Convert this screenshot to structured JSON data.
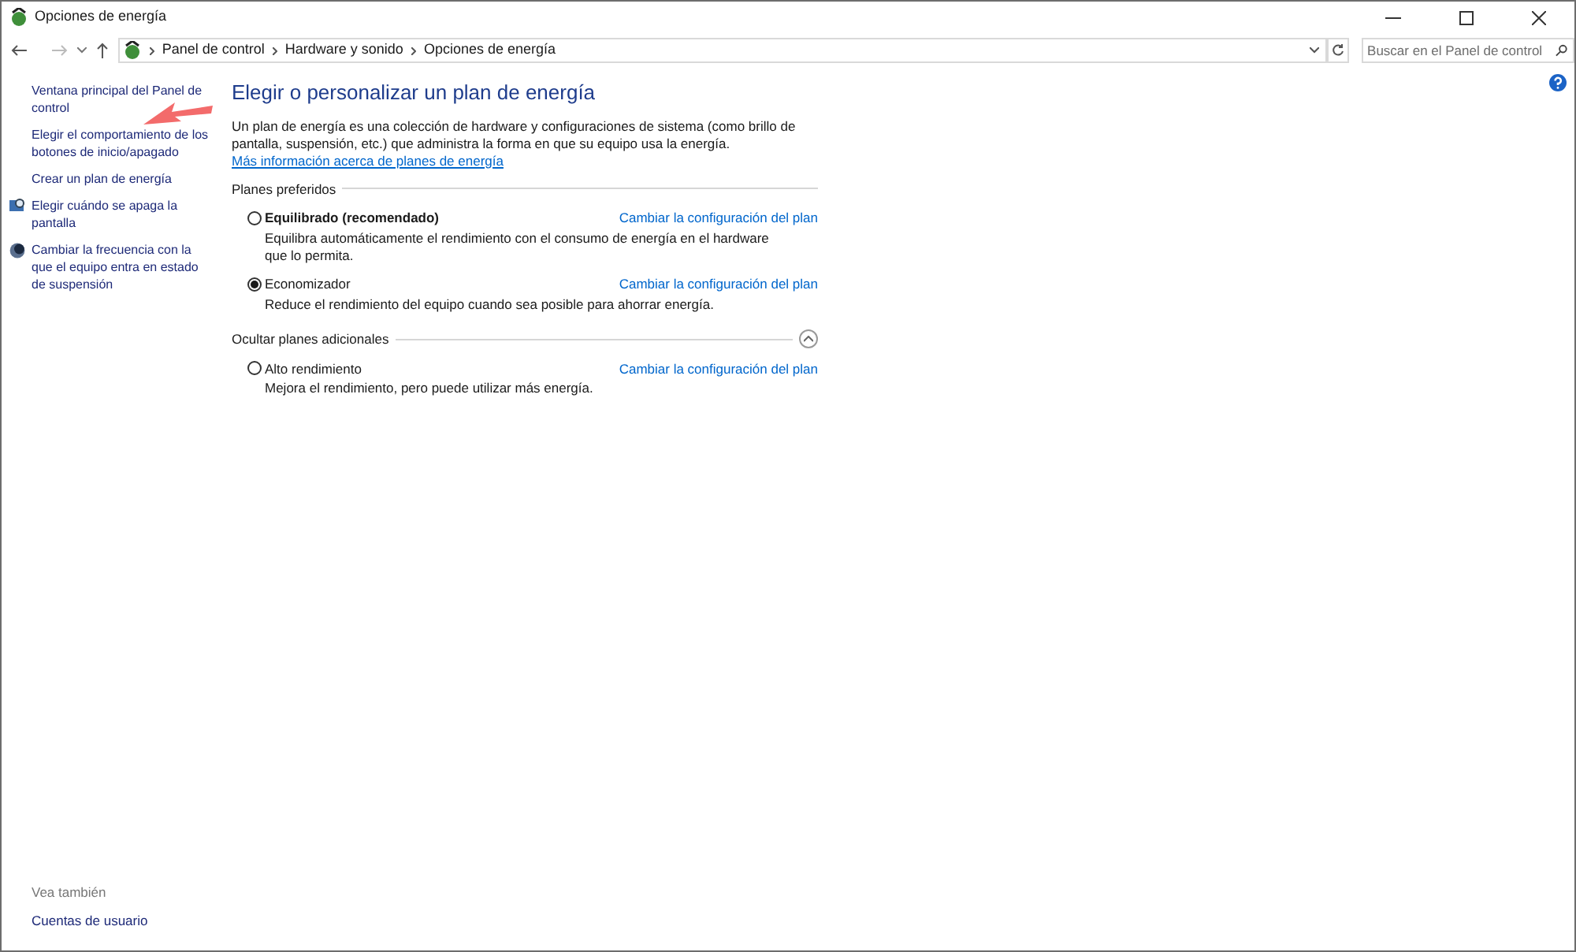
{
  "window": {
    "title": "Opciones de energía"
  },
  "breadcrumb": [
    "Panel de control",
    "Hardware y sonido",
    "Opciones de energía"
  ],
  "search": {
    "placeholder": "Buscar en el Panel de control"
  },
  "sidebar": {
    "items": [
      {
        "label": "Ventana principal del Panel de control",
        "kind": "plain"
      },
      {
        "label": "Elegir el comportamiento de los botones de inicio/apagado",
        "kind": "plain"
      },
      {
        "label": "Crear un plan de energía",
        "kind": "plain"
      },
      {
        "label": "Elegir cuándo se apaga la pantalla",
        "kind": "monitor"
      },
      {
        "label": "Cambiar la frecuencia con la que el equipo entra en estado de suspensión",
        "kind": "moon"
      }
    ],
    "see_also": {
      "heading": "Vea también",
      "links": [
        "Cuentas de usuario"
      ]
    }
  },
  "main": {
    "title": "Elegir o personalizar un plan de energía",
    "intro": "Un plan de energía es una colección de hardware y configuraciones de sistema (como brillo de pantalla, suspensión, etc.) que administra la forma en que su equipo usa la energía.",
    "intro_link": "Más información acerca de planes de energía",
    "groups": [
      {
        "heading": "Planes preferidos",
        "collapsible": false,
        "plans": [
          {
            "name": "Equilibrado (recomendado)",
            "bold": true,
            "selected": false,
            "description": "Equilibra automáticamente el rendimiento con el consumo de energía en el hardware que lo permita.",
            "link": "Cambiar la configuración del plan"
          },
          {
            "name": "Economizador",
            "bold": false,
            "selected": true,
            "description": "Reduce el rendimiento del equipo cuando sea posible para ahorrar energía.",
            "link": "Cambiar la configuración del plan"
          }
        ]
      },
      {
        "heading": "Ocultar planes adicionales",
        "collapsible": true,
        "plans": [
          {
            "name": "Alto rendimiento",
            "bold": false,
            "selected": false,
            "description": "Mejora el rendimiento, pero puede utilizar más energía.",
            "link": "Cambiar la configuración del plan"
          }
        ]
      }
    ]
  },
  "annotation": {
    "kind": "arrow"
  }
}
